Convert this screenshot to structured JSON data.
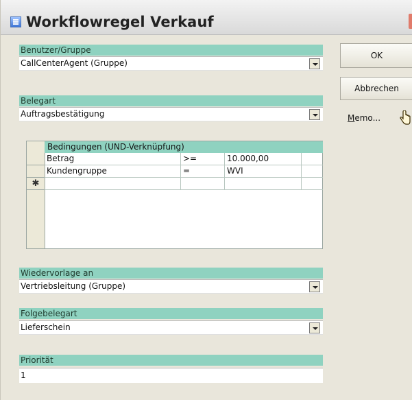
{
  "window": {
    "title": "Workflowregel Verkauf"
  },
  "fields": {
    "benutzer": {
      "label": "Benutzer/Gruppe",
      "value": "CallCenterAgent (Gruppe)"
    },
    "belegart": {
      "label": "Belegart",
      "value": "Auftragsbestätigung"
    },
    "wiedervorlage": {
      "label": "Wiedervorlage an",
      "value": "Vertriebsleitung (Gruppe)"
    },
    "folgebelegart": {
      "label": "Folgebelegart",
      "value": "Lieferschein"
    },
    "prioritaet": {
      "label": "Priorität",
      "value": "1"
    }
  },
  "conditions": {
    "caption": "Bedingungen (UND-Verknüpfung)",
    "new_row_marker": "✱",
    "rows": [
      {
        "field": "Betrag",
        "operator": ">=",
        "value": "10.000,00"
      },
      {
        "field": "Kundengruppe",
        "operator": "=",
        "value": "WVI"
      }
    ]
  },
  "buttons": {
    "ok": "OK",
    "cancel": "Abbrechen",
    "memo_accel": "M",
    "memo_rest": "emo..."
  },
  "icons": {
    "window": "app-window-icon",
    "dropdown": "chevron-down-icon",
    "cursor": "hand-cursor-icon"
  }
}
